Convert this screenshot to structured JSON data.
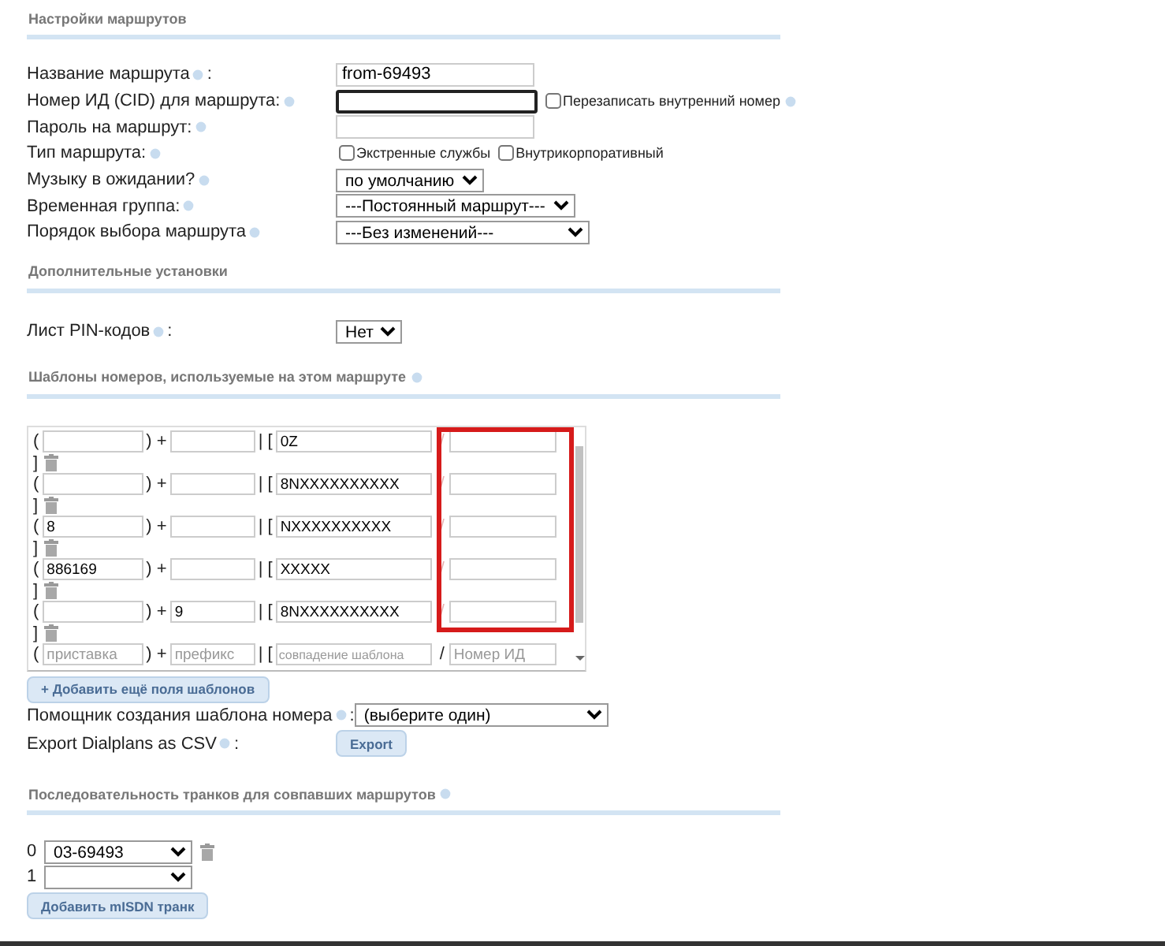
{
  "route_settings": {
    "title": "Настройки маршрутов",
    "fields": [
      {
        "kind": "text",
        "label": "Название маршрута",
        "help": true,
        "suffix": " :",
        "value": "from-69493"
      },
      {
        "kind": "text",
        "label": "Номер ИД (CID) для маршрута:",
        "help": true,
        "focused": true,
        "checkbox": {
          "label": "Перезаписать внутренний номер",
          "checked": false,
          "help": true
        }
      },
      {
        "kind": "text",
        "label": "Пароль на маршрут:",
        "help": true
      },
      {
        "kind": "checkboxes",
        "label": "Тип маршрута:",
        "help": true,
        "options": [
          {
            "label": "Экстренные службы",
            "checked": false
          },
          {
            "label": "Внутрикорпоративный",
            "checked": false
          }
        ]
      },
      {
        "kind": "select",
        "label": "Музыку в ожидании?",
        "help": true,
        "value": "по умолчанию"
      },
      {
        "kind": "select",
        "label": "Временная группа:",
        "help": true,
        "value": "---Постоянный маршрут---"
      },
      {
        "kind": "select",
        "label": "Порядок выбора маршрута",
        "help": true,
        "value": "---Без изменений---"
      }
    ]
  },
  "additional": {
    "title": "Дополнительные установки",
    "fields": [
      {
        "kind": "select",
        "label": "Лист PIN-кодов",
        "help": true,
        "suffix": " :",
        "value": "Нет"
      }
    ]
  },
  "patterns": {
    "title": "Шаблоны номеров, используемые на этом маршруте",
    "help": true,
    "rows": [
      {
        "kind": "filled",
        "open": "(",
        "prepend": "",
        "plus": ") +",
        "prefix": "",
        "bar": "| [",
        "pattern": "0Z",
        "slash": "/",
        "callerid": "",
        "close": "]"
      },
      {
        "kind": "filled",
        "open": "(",
        "prepend": "",
        "plus": ") +",
        "prefix": "",
        "bar": "| [",
        "pattern": "8NXXXXXXXXXX",
        "slash": "/",
        "callerid": "",
        "close": "]"
      },
      {
        "kind": "filled",
        "open": "(",
        "prepend": "8",
        "plus": ") +",
        "prefix": "",
        "bar": "| [",
        "pattern": "NXXXXXXXXXX",
        "slash": "/",
        "callerid": "",
        "close": "]"
      },
      {
        "kind": "filled",
        "open": "(",
        "prepend": "886169",
        "plus": ") +",
        "prefix": "",
        "bar": "| [",
        "pattern": "XXXXX",
        "slash": "/",
        "callerid": "",
        "close": "]"
      },
      {
        "kind": "filled",
        "open": "(",
        "prepend": "",
        "plus": ") +",
        "prefix": "9",
        "bar": "| [",
        "pattern": "8NXXXXXXXXXX",
        "slash": "/",
        "callerid": "",
        "close": "]"
      },
      {
        "kind": "new",
        "open": "(",
        "prepend_placeholder": "приставка",
        "plus": ") +",
        "prefix_placeholder": "префикс",
        "bar": "| [",
        "pattern_placeholder": "совпадение шаблона",
        "slash": "/",
        "callerid_placeholder": "Номер ИД"
      }
    ],
    "add_button": "+ Добавить ещё поля шаблонов",
    "wizard": {
      "label": "Помощник создания шаблона номера",
      "help": true,
      "suffix": " :",
      "value": "(выберите один)"
    },
    "export": {
      "label": "Export Dialplans as CSV",
      "help": true,
      "suffix": " :",
      "button": "Export"
    }
  },
  "trunks": {
    "title": "Последовательность транков для совпавших маршрутов",
    "help": true,
    "rows": [
      {
        "index": "0",
        "value": "03-69493",
        "deletable": true
      },
      {
        "index": "1",
        "deletable": false
      }
    ],
    "add_button": "Добавить mISDN транк"
  }
}
